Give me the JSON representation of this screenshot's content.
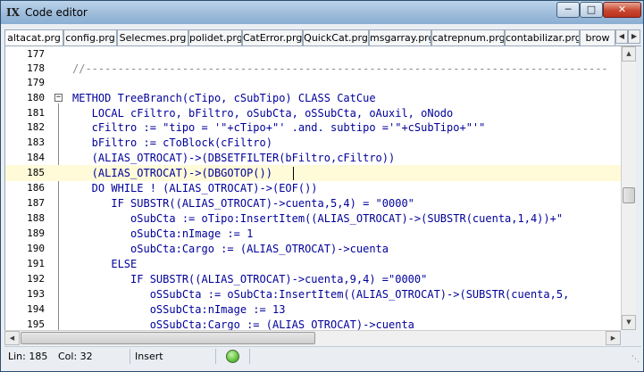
{
  "window": {
    "title": "Code editor",
    "app_icon": "IX",
    "controls": {
      "minimize": "minimize-icon",
      "maximize": "maximize-icon",
      "close": "close-icon"
    }
  },
  "tabs": [
    {
      "label": "altacat.prg"
    },
    {
      "label": "config.prg"
    },
    {
      "label": "Selecmes.prg"
    },
    {
      "label": "polidet.prg"
    },
    {
      "label": "CatError.prg"
    },
    {
      "label": "QuickCat.prg"
    },
    {
      "label": "msgarray.prg"
    },
    {
      "label": "catrepnum.prg"
    },
    {
      "label": "contabilizar.prg"
    },
    {
      "label": "brow"
    }
  ],
  "editor": {
    "highlight_color": "#fffbd8",
    "code_color": "#00009a",
    "lines": [
      {
        "num": "177",
        "text": ""
      },
      {
        "num": "178",
        "text": "//---------------------------------------------------------------------------------"
      },
      {
        "num": "179",
        "text": ""
      },
      {
        "num": "180",
        "text": "METHOD TreeBranch(cTipo, cSubTipo) CLASS CatCue"
      },
      {
        "num": "181",
        "text": "   LOCAL cFiltro, bFiltro, oSubCta, oSSubCta, oAuxil, oNodo"
      },
      {
        "num": "182",
        "text": "   cFiltro := \"tipo = '\"+cTipo+\"' .and. subtipo ='\"+cSubTipo+\"'\""
      },
      {
        "num": "183",
        "text": "   bFiltro := cToBlock(cFiltro)"
      },
      {
        "num": "184",
        "text": "   (ALIAS_OTROCAT)->(DBSETFILTER(bFiltro,cFiltro))"
      },
      {
        "num": "185",
        "text": "   (ALIAS_OTROCAT)->(DBGOTOP())"
      },
      {
        "num": "186",
        "text": "   DO WHILE ! (ALIAS_OTROCAT)->(EOF())"
      },
      {
        "num": "187",
        "text": "      IF SUBSTR((ALIAS_OTROCAT)->cuenta,5,4) = \"0000\""
      },
      {
        "num": "188",
        "text": "         oSubCta := oTipo:InsertItem((ALIAS_OTROCAT)->(SUBSTR(cuenta,1,4))+\""
      },
      {
        "num": "189",
        "text": "         oSubCta:nImage := 1"
      },
      {
        "num": "190",
        "text": "         oSubCta:Cargo := (ALIAS_OTROCAT)->cuenta"
      },
      {
        "num": "191",
        "text": "      ELSE"
      },
      {
        "num": "192",
        "text": "         IF SUBSTR((ALIAS_OTROCAT)->cuenta,9,4) =\"0000\""
      },
      {
        "num": "193",
        "text": "            oSSubCta := oSubCta:InsertItem((ALIAS_OTROCAT)->(SUBSTR(cuenta,5,"
      },
      {
        "num": "194",
        "text": "            oSSubCta:nImage := 13"
      },
      {
        "num": "195",
        "text": "            oSSubCta:Cargo := (ALIAS_OTROCAT)->cuenta"
      }
    ]
  },
  "statusbar": {
    "line": "Lin: 185",
    "col": "Col: 32",
    "mode": "Insert",
    "indicator_color": "#5fc23a"
  }
}
